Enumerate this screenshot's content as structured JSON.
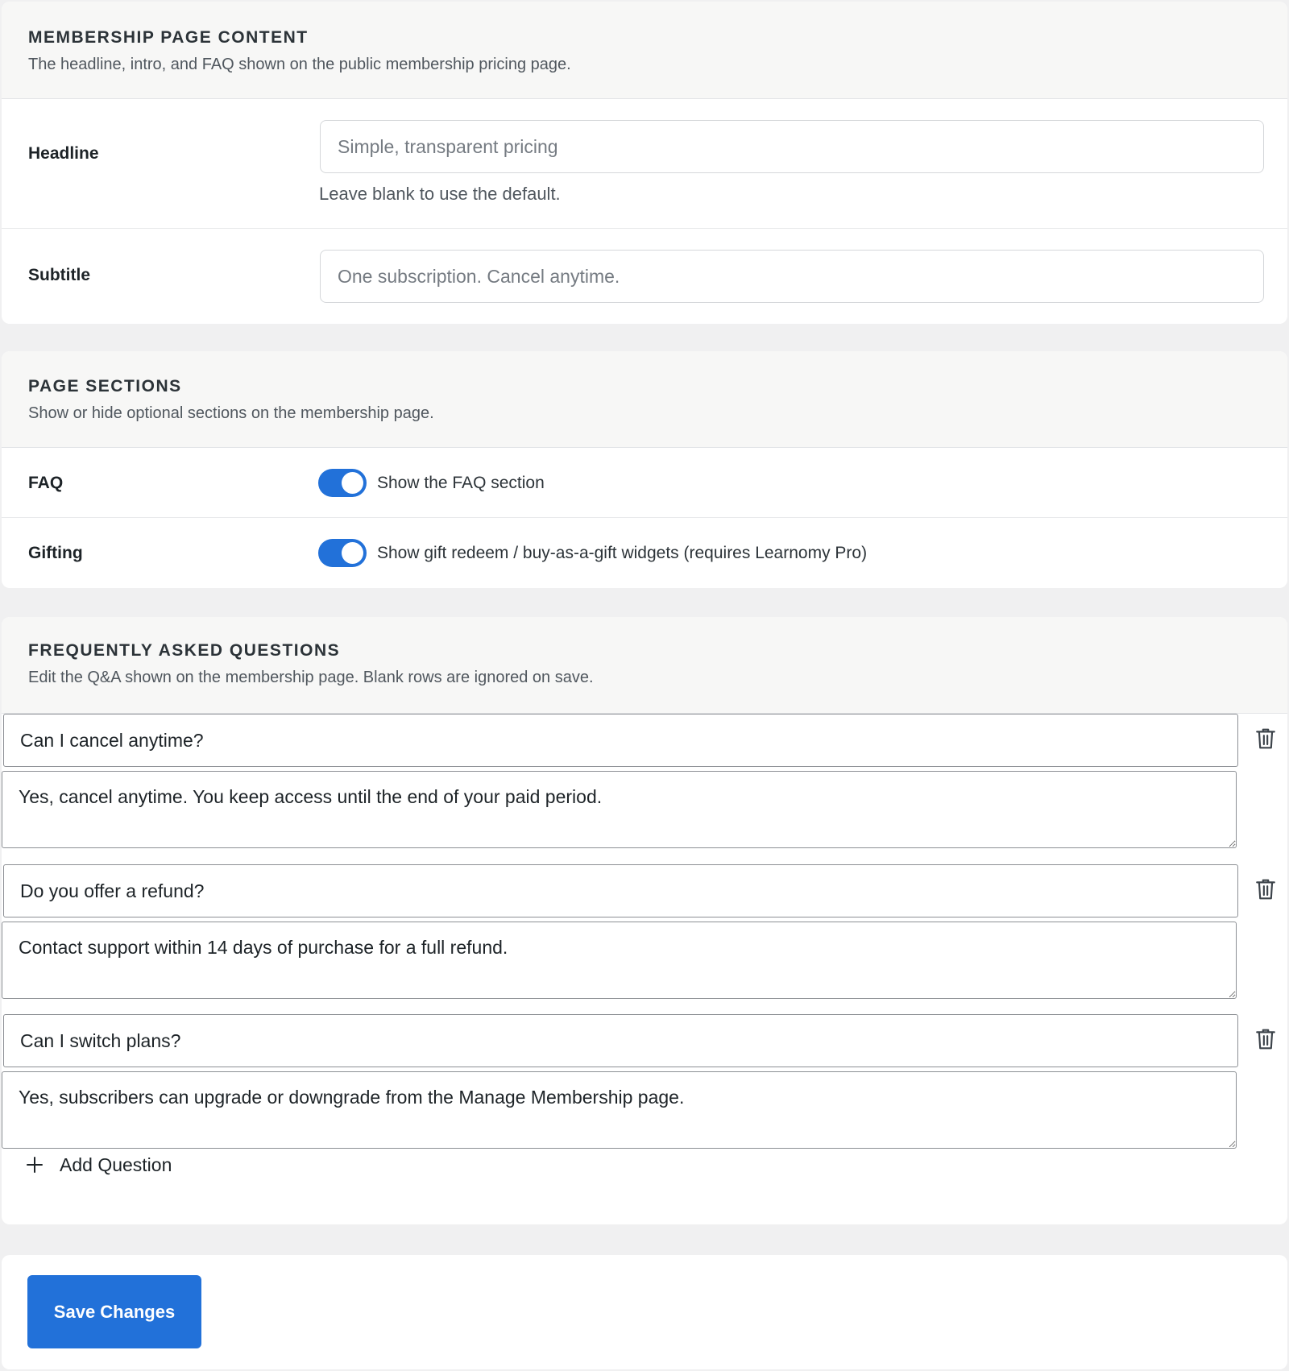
{
  "membership_content": {
    "title": "MEMBERSHIP PAGE CONTENT",
    "description": "The headline, intro, and FAQ shown on the public membership pricing page.",
    "headline_label": "Headline",
    "headline_placeholder": "Simple, transparent pricing",
    "headline_value": "",
    "headline_help": "Leave blank to use the default.",
    "subtitle_label": "Subtitle",
    "subtitle_placeholder": "One subscription. Cancel anytime.",
    "subtitle_value": ""
  },
  "page_sections": {
    "title": "PAGE SECTIONS",
    "description": "Show or hide optional sections on the membership page.",
    "faq_label": "FAQ",
    "faq_toggle_text": "Show the FAQ section",
    "faq_enabled": true,
    "gifting_label": "Gifting",
    "gifting_toggle_text": "Show gift redeem / buy-as-a-gift widgets (requires Learnomy Pro)",
    "gifting_enabled": true,
    "toggle_on_color": "#2271d9"
  },
  "faq": {
    "title": "FREQUENTLY ASKED QUESTIONS",
    "description": "Edit the Q&A shown on the membership page. Blank rows are ignored on save.",
    "items": [
      {
        "question": "Can I cancel anytime?",
        "answer": "Yes, cancel anytime. You keep access until the end of your paid period."
      },
      {
        "question": "Do you offer a refund?",
        "answer": "Contact support within 14 days of purchase for a full refund."
      },
      {
        "question": "Can I switch plans?",
        "answer": "Yes, subscribers can upgrade or downgrade from the Manage Membership page."
      }
    ],
    "delete_icon": "trash-icon",
    "add_icon": "plus-icon",
    "add_label": "Add Question"
  },
  "footer": {
    "save_label": "Save Changes",
    "accent_color": "#2271d9"
  }
}
